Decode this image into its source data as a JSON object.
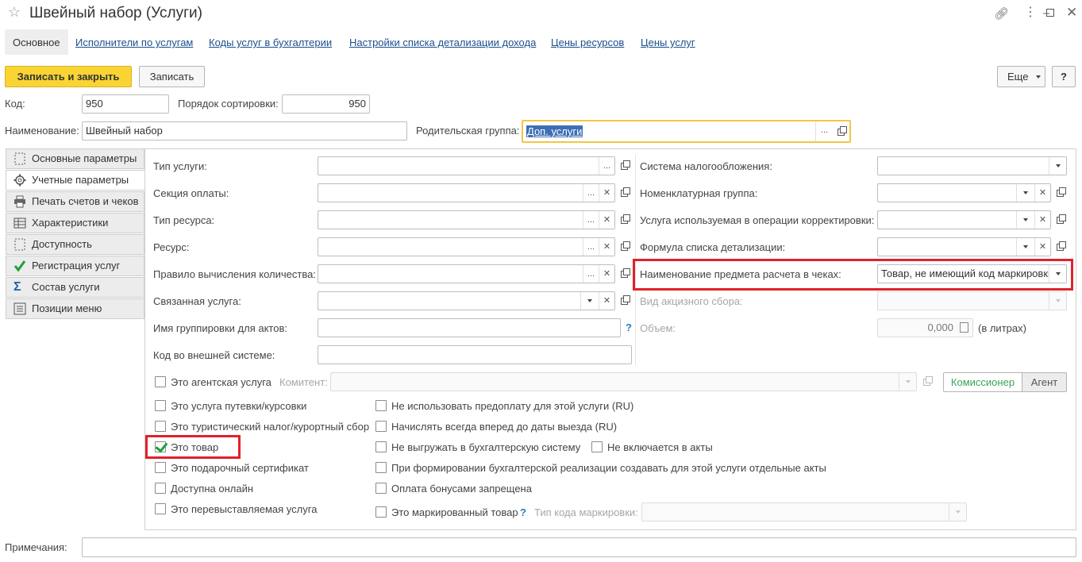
{
  "window": {
    "title": "Швейный набор (Услуги)"
  },
  "nav": {
    "tabs": [
      "Основное",
      "Исполнители по услугам",
      "Коды услуг в бухгалтерии",
      "Настройки списка детализации дохода",
      "Цены ресурсов",
      "Цены услуг"
    ]
  },
  "toolbar": {
    "save_close": "Записать и закрыть",
    "save": "Записать",
    "more": "Еще",
    "help": "?"
  },
  "header_fields": {
    "code_label": "Код:",
    "code_value": "950",
    "sort_label": "Порядок сортировки:",
    "sort_value": "950",
    "name_label": "Наименование:",
    "name_value": "Швейный набор",
    "parent_label": "Родительская группа:",
    "parent_value": "Доп. услуги"
  },
  "side_tabs": [
    {
      "label": "Основные параметры",
      "icon": "dashed-frame-icon"
    },
    {
      "label": "Учетные параметры",
      "icon": "gear-icon"
    },
    {
      "label": "Печать счетов и чеков",
      "icon": "printer-icon"
    },
    {
      "label": "Характеристики",
      "icon": "grid-icon"
    },
    {
      "label": "Доступность",
      "icon": "dashed-frame-icon"
    },
    {
      "label": "Регистрация услуг",
      "icon": "green-check-icon"
    },
    {
      "label": "Состав услуги",
      "icon": "sigma-icon"
    },
    {
      "label": "Позиции меню",
      "icon": "list-icon"
    }
  ],
  "left_form": {
    "service_type": "Тип услуги:",
    "payment_section": "Секция оплаты:",
    "resource_type": "Тип ресурса:",
    "resource": "Ресурс:",
    "qty_rule": "Правило вычисления количества:",
    "linked_service": "Связанная услуга:",
    "act_group_name": "Имя группировки для актов:",
    "ext_code": "Код во внешней системе:"
  },
  "right_form": {
    "tax_system": "Система налогообложения:",
    "nomenclature_group": "Номенклатурная группа:",
    "correction_service": "Услуга используемая в операции корректировки:",
    "detail_formula": "Формула списка детализации:",
    "receipt_subject_label": "Наименование предмета расчета в чеках:",
    "receipt_subject_value": "Товар, не имеющий код маркировки",
    "excise_type": "Вид акцизного сбора:",
    "volume_label": "Объем:",
    "volume_value": "0,000",
    "volume_unit": "(в литрах)"
  },
  "agent": {
    "label": "Это агентская услуга",
    "committent_label": "Комитент:",
    "btn_commission": "Комиссионер",
    "btn_agent": "Агент"
  },
  "checks_left": [
    {
      "label": "Это услуга путевки/курсовки",
      "checked": false
    },
    {
      "label": "Это туристический налог/курортный сбор",
      "checked": false
    },
    {
      "label": "Это товар",
      "checked": true
    },
    {
      "label": "Это подарочный сертификат",
      "checked": false
    },
    {
      "label": "Доступна онлайн",
      "checked": false
    },
    {
      "label": "Это перевыставляемая услуга",
      "checked": false
    }
  ],
  "checks_right": {
    "no_prepay": "Не использовать предоплату для этой услуги (RU)",
    "charge_ahead": "Начислять всегда вперед до даты выезда (RU)",
    "no_export": "Не выгружать в бухгалтерскую систему",
    "not_in_acts": "Не включается в акты",
    "separate_acts": "При формировании бухгалтерской реализации создавать для этой услуги отдельные акты",
    "no_bonus": "Оплата бонусами запрещена",
    "marked_goods": "Это маркированный товар",
    "marking_code_type": "Тип кода маркировки:"
  },
  "notes_label": "Примечания:",
  "colors": {
    "accent_yellow": "#f9d433",
    "link_blue": "#1c4f8c",
    "highlight_red": "#e0222a",
    "check_green": "#1f9e3a",
    "commission_green": "#3aa35a"
  }
}
